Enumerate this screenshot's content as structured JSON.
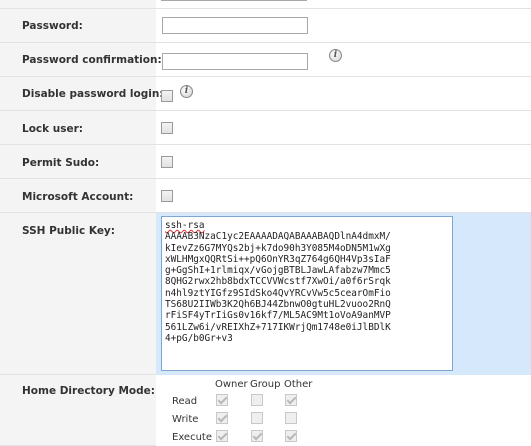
{
  "fields": {
    "password": {
      "label": "Password:",
      "value": ""
    },
    "password_confirmation": {
      "label": "Password confirmation:",
      "value": ""
    },
    "disable_password_login": {
      "label": "Disable password login:",
      "checked": false
    },
    "lock_user": {
      "label": "Lock user:",
      "checked": false
    },
    "permit_sudo": {
      "label": "Permit Sudo:",
      "checked": false
    },
    "microsoft_account": {
      "label": "Microsoft Account:",
      "checked": false
    },
    "ssh_public_key": {
      "label": "SSH Public Key:",
      "first_line": "ssh-rsa",
      "value": "AAAAB3NzaC1yc2EAAAADAQABAAABAQDlnA4dmxM/\nkIevZz6G7MYQs2bj+k7do90h3Y085M4oDN5M1wXg\nxWLHMgxQQRtSi++pQ6OnYR3qZ764g6QH4Vp3sIaF\ng+GgShI+1rlmiqx/vGojgBTBLJawLAfabzw7Mmc5\n8QHG2rwx2hb8bdxTCCVVWcstf7XwOi/a0f6rSrqk\nn4hl9ztYIGfz9SIdSko4QvYRCvVw5c5cearOmFio\nTS68U2IIWb3K2Qh6BJ44ZbnwO0gtuHL2vuoo2RnQ\nrFiSF4yTrIiGs0v16kf7/ML5AC9Mt1oVoA9anMVP\n561LZw6i/vREIXhZ+717IKWrjQm1748e0iJlBDlK\n4+pG/b0Gr+v3"
    },
    "home_directory_mode": {
      "label": "Home Directory Mode:",
      "columns": [
        "Owner",
        "Group",
        "Other"
      ],
      "rows": [
        {
          "label": "Read",
          "values": [
            true,
            false,
            true
          ]
        },
        {
          "label": "Write",
          "values": [
            true,
            false,
            false
          ]
        },
        {
          "label": "Execute",
          "values": [
            true,
            true,
            true
          ]
        }
      ]
    }
  },
  "icons": {
    "info": "info-icon"
  },
  "info_glyph": "i",
  "colors": {
    "label_bg": "#f4f4f4",
    "ssh_row_bg": "#d6e8fb",
    "border": "#e2e2e2"
  }
}
